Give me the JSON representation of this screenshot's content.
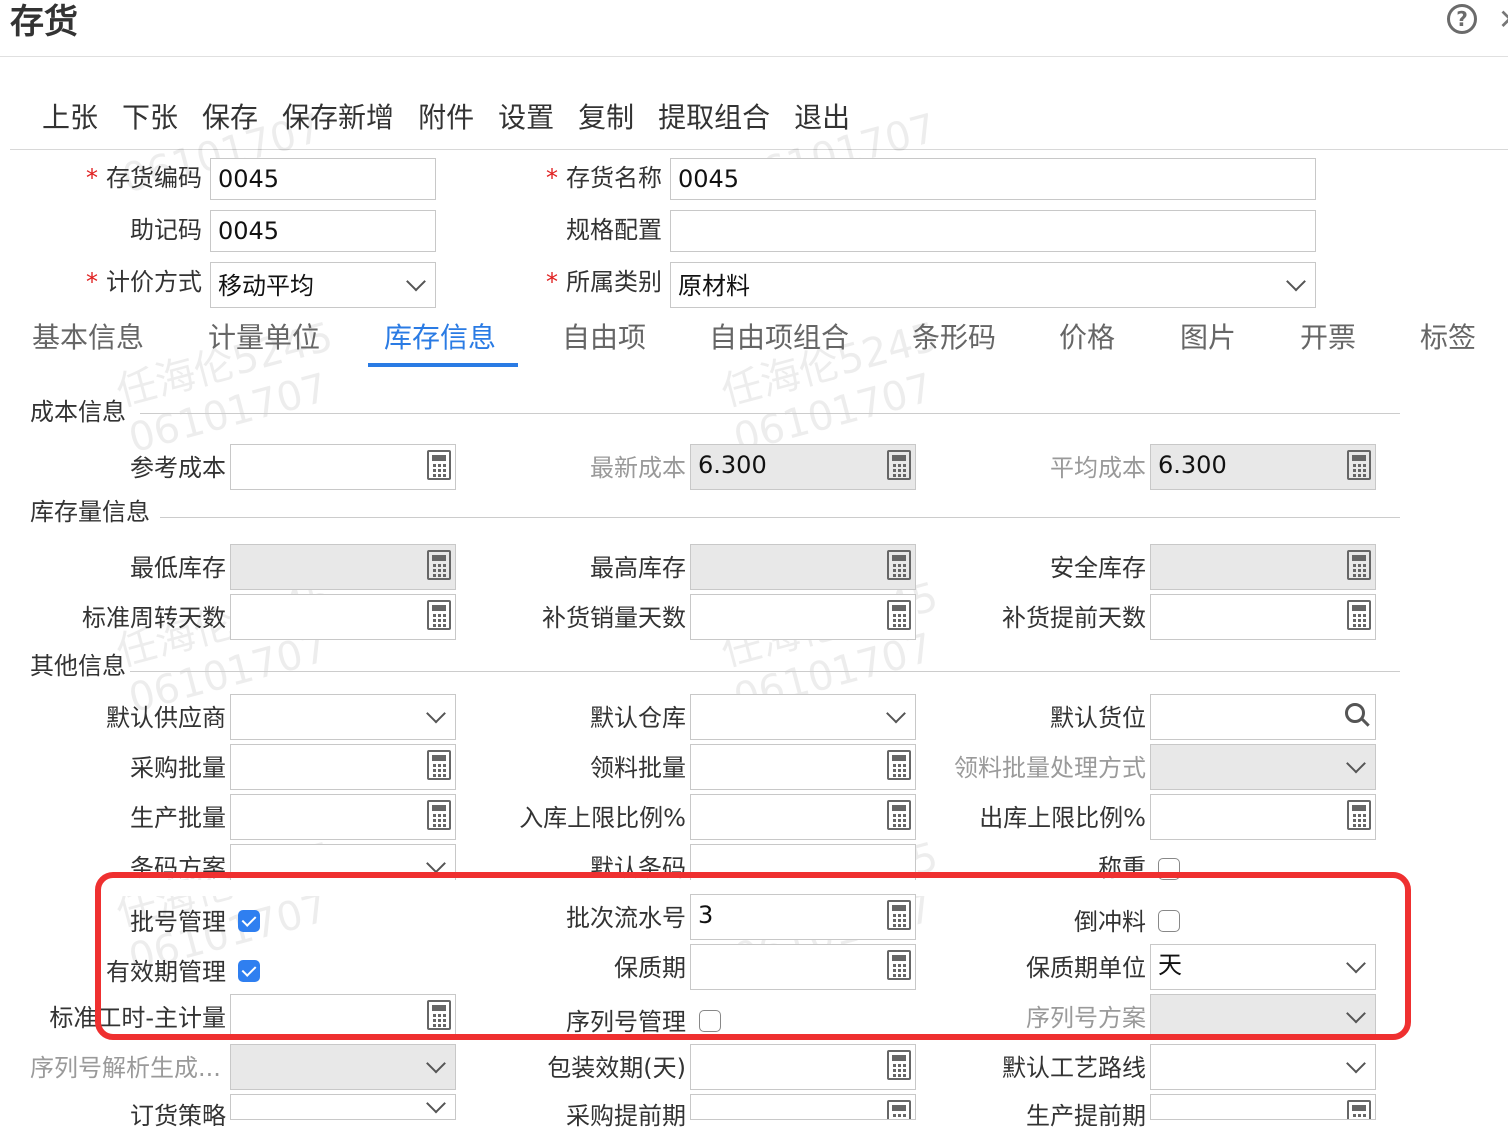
{
  "header": {
    "title": "存货"
  },
  "toolbar": {
    "items": [
      "上张",
      "下张",
      "保存",
      "保存新增",
      "附件",
      "设置",
      "复制",
      "提取组合",
      "退出"
    ]
  },
  "top_form": {
    "code": {
      "label": "存货编码",
      "value": "0045"
    },
    "name": {
      "label": "存货名称",
      "value": "0045"
    },
    "mnemonic": {
      "label": "助记码",
      "value": "0045"
    },
    "spec": {
      "label": "规格配置",
      "value": ""
    },
    "pricing": {
      "label": "计价方式",
      "value": "移动平均"
    },
    "category": {
      "label": "所属类别",
      "value": "原材料"
    }
  },
  "tabs": [
    "基本信息",
    "计量单位",
    "库存信息",
    "自由项",
    "自由项组合",
    "条形码",
    "价格",
    "图片",
    "开票",
    "标签"
  ],
  "sections": {
    "cost": "成本信息",
    "stock": "库存量信息",
    "other": "其他信息"
  },
  "cost": {
    "ref": {
      "label": "参考成本",
      "value": ""
    },
    "latest": {
      "label": "最新成本",
      "value": "6.300"
    },
    "avg": {
      "label": "平均成本",
      "value": "6.300"
    }
  },
  "stock": {
    "min": {
      "label": "最低库存"
    },
    "max": {
      "label": "最高库存"
    },
    "safe": {
      "label": "安全库存"
    },
    "turnover": {
      "label": "标准周转天数"
    },
    "replenish_sales": {
      "label": "补货销量天数"
    },
    "replenish_lead": {
      "label": "补货提前天数"
    }
  },
  "other": {
    "supplier": {
      "label": "默认供应商"
    },
    "warehouse": {
      "label": "默认仓库"
    },
    "location": {
      "label": "默认货位"
    },
    "purchase_batch": {
      "label": "采购批量"
    },
    "pick_batch": {
      "label": "领料批量"
    },
    "pick_batch_mode": {
      "label": "领料批量处理方式"
    },
    "prod_batch": {
      "label": "生产批量"
    },
    "in_limit": {
      "label": "入库上限比例%"
    },
    "out_limit": {
      "label": "出库上限比例%"
    },
    "barcode_scheme": {
      "label": "条码方案"
    },
    "default_barcode": {
      "label": "默认条码"
    },
    "weigh": {
      "label": "称重"
    },
    "batch_mgmt": {
      "label": "批号管理",
      "checked": true
    },
    "batch_serial": {
      "label": "批次流水号",
      "value": "3"
    },
    "backflush": {
      "label": "倒冲料",
      "checked": false
    },
    "expiry_mgmt": {
      "label": "有效期管理",
      "checked": true
    },
    "shelf_life": {
      "label": "保质期",
      "value": ""
    },
    "shelf_unit": {
      "label": "保质期单位",
      "value": "天"
    },
    "std_hours": {
      "label": "标准工时-主计量"
    },
    "serial_mgmt": {
      "label": "序列号管理",
      "checked": false
    },
    "serial_scheme": {
      "label": "序列号方案"
    },
    "serial_parse": {
      "label": "序列号解析生成..."
    },
    "pack_valid": {
      "label": "包装效期(天)"
    },
    "route": {
      "label": "默认工艺路线"
    },
    "order_strategy": {
      "label": "订货策略"
    },
    "purchase_lead": {
      "label": "采购提前期"
    },
    "prod_lead": {
      "label": "生产提前期"
    }
  },
  "watermark": {
    "name": "任海伦5245",
    "id": "06101707"
  },
  "colors": {
    "accent": "#2a7be4",
    "required": "#e02020",
    "highlight": "#ef3030",
    "checkbox": "#2f7ff0"
  }
}
